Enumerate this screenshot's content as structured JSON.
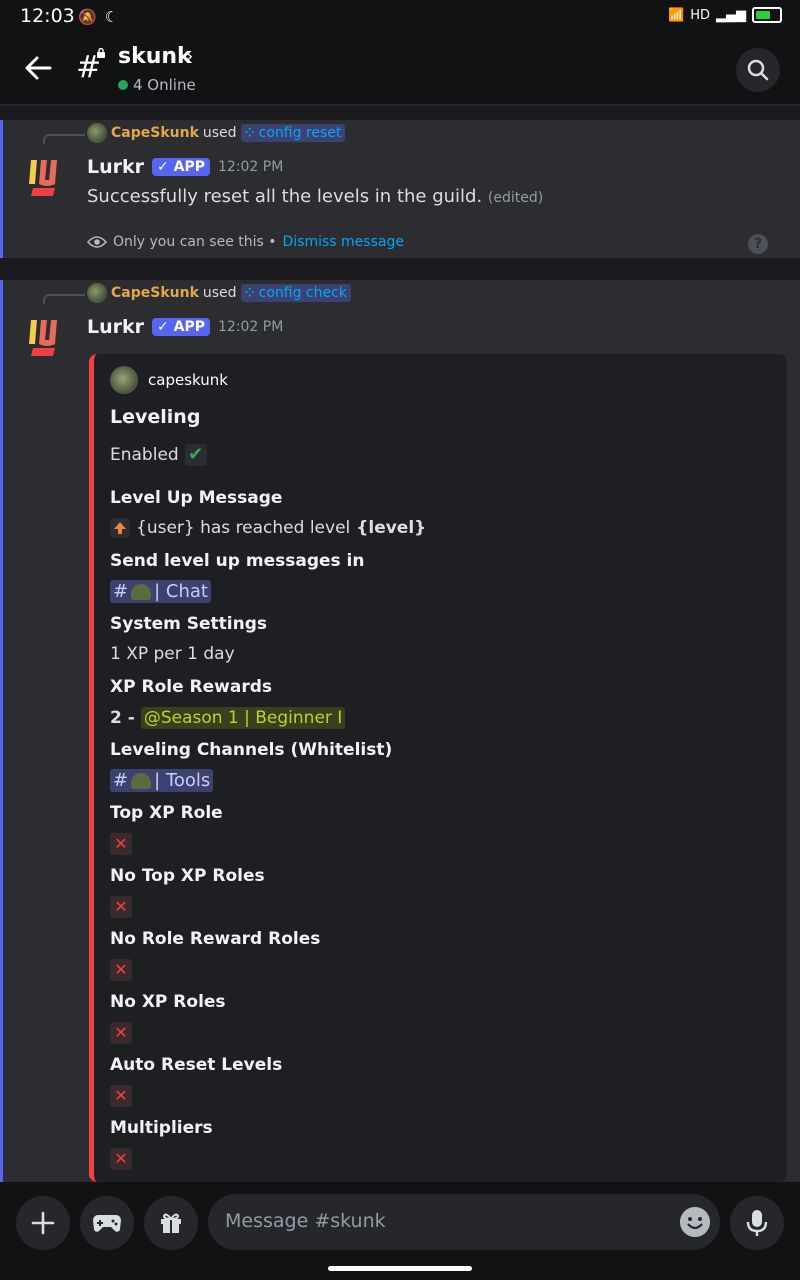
{
  "status": {
    "time": "12:03",
    "network": "HD"
  },
  "header": {
    "channel": "skunk",
    "online": "4 Online"
  },
  "messages": [
    {
      "ref_user": "CapeSkunk",
      "ref_used": "used",
      "command": "config reset",
      "author": "Lurkr",
      "badge": "APP",
      "time": "12:02 PM",
      "content": "Successfully reset all the levels in the guild.",
      "edited": "(edited)",
      "ephemeral_text": "Only you can see this •",
      "dismiss": "Dismiss message"
    },
    {
      "ref_user": "CapeSkunk",
      "ref_used": "used",
      "command": "config check",
      "author": "Lurkr",
      "badge": "APP",
      "time": "12:02 PM"
    }
  ],
  "embed": {
    "author": "capeskunk",
    "title": "Leveling",
    "enabled": "Enabled",
    "fields": {
      "level_up_message": "Level Up Message",
      "level_up_text": "{user} has reached level",
      "level_up_bold": "{level}",
      "send_in": "Send level up messages in",
      "send_in_channel": "| Chat",
      "system": "System Settings",
      "system_val": "1 XP per 1 day",
      "xp_role_rewards": "XP Role Rewards",
      "xp_role_num": "2 -",
      "xp_role_mention": "@Season 1 | Beginner I",
      "leveling_channels": "Leveling Channels (Whitelist)",
      "leveling_channel": "| Tools",
      "top_xp_role": "Top XP Role",
      "no_top_xp_roles": "No Top XP Roles",
      "no_role_reward_roles": "No Role Reward Roles",
      "no_xp_roles": "No XP Roles",
      "auto_reset": "Auto Reset Levels",
      "multipliers": "Multipliers"
    }
  },
  "composer": {
    "placeholder": "Message #skunk"
  },
  "colors": {
    "blurple": "#5865f2",
    "red": "#f23f43",
    "online": "#23a55a",
    "link": "#00a8fc"
  },
  "icons": [
    "back-arrow-icon",
    "hash-lock-icon",
    "search-icon",
    "eye-icon",
    "help-icon",
    "plus-icon",
    "gamepad-icon",
    "gift-icon",
    "emoji-icon",
    "mic-icon"
  ]
}
